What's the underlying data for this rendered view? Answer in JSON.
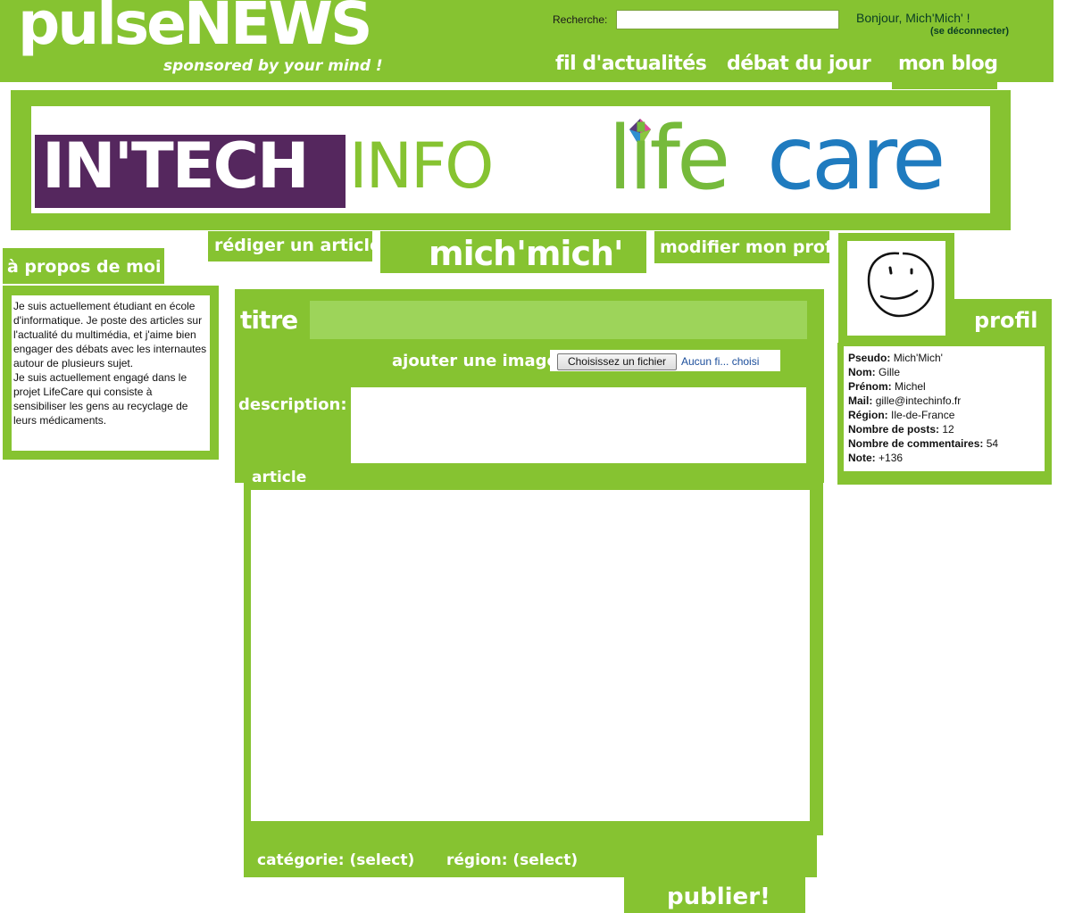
{
  "header": {
    "logo": "pulseNEWS",
    "slogan": "sponsored by your mind !",
    "search_label": "Recherche:",
    "search_value": "",
    "greeting": "Bonjour, Mich'Mich' !",
    "logout": "(se déconnecter)"
  },
  "nav": {
    "items": [
      {
        "label": "fil d'actualités"
      },
      {
        "label": "débat du jour"
      },
      {
        "label": "mon blog",
        "active": true
      }
    ]
  },
  "banner": {
    "brand_1a": "IN'TECH",
    "brand_1b": "INFO",
    "brand_2a": "life",
    "brand_2b": "care"
  },
  "tabs": {
    "write": "rédiger un article",
    "username": "mich'mich'",
    "edit_profile": "modifier mon profil"
  },
  "about": {
    "title": "à propos de moi",
    "text": "Je suis actuellement étudiant en école d'informatique. Je poste des articles sur l'actualité du multimédia, et j'aime bien engager des débats avec les internautes autour de plusieurs sujet.\nJe suis actuellement engagé dans le projet LifeCare qui consiste à sensibiliser les gens au recyclage de leurs médicaments."
  },
  "form": {
    "title_label": "titre",
    "title_value": "",
    "image_label": "ajouter une image",
    "file_button": "Choisissez un fichier",
    "file_status": "Aucun fi... choisi",
    "description_label": "description:",
    "description_value": "",
    "article_label": "article",
    "article_value": "",
    "category_label": "catégorie: (select)",
    "region_label": "région: (select)",
    "publish": "publier!"
  },
  "profile": {
    "title": "profil",
    "fields": [
      {
        "label": "Pseudo:",
        "value": "Mich'Mich'"
      },
      {
        "label": "Nom:",
        "value": "Gille"
      },
      {
        "label": "Prénom:",
        "value": "Michel"
      },
      {
        "label": "Mail:",
        "value": "gille@intechinfo.fr"
      },
      {
        "label": "Région:",
        "value": "Ile-de-France"
      },
      {
        "label": "Nombre de posts:",
        "value": "12"
      },
      {
        "label": "Nombre de commentaires:",
        "value": "54"
      },
      {
        "label": "Note:",
        "value": "+136"
      }
    ]
  },
  "colors": {
    "brand_green": "#86c331",
    "light_green": "#9dd45a",
    "intech_purple": "#55275e",
    "care_blue": "#1f7bbf"
  }
}
